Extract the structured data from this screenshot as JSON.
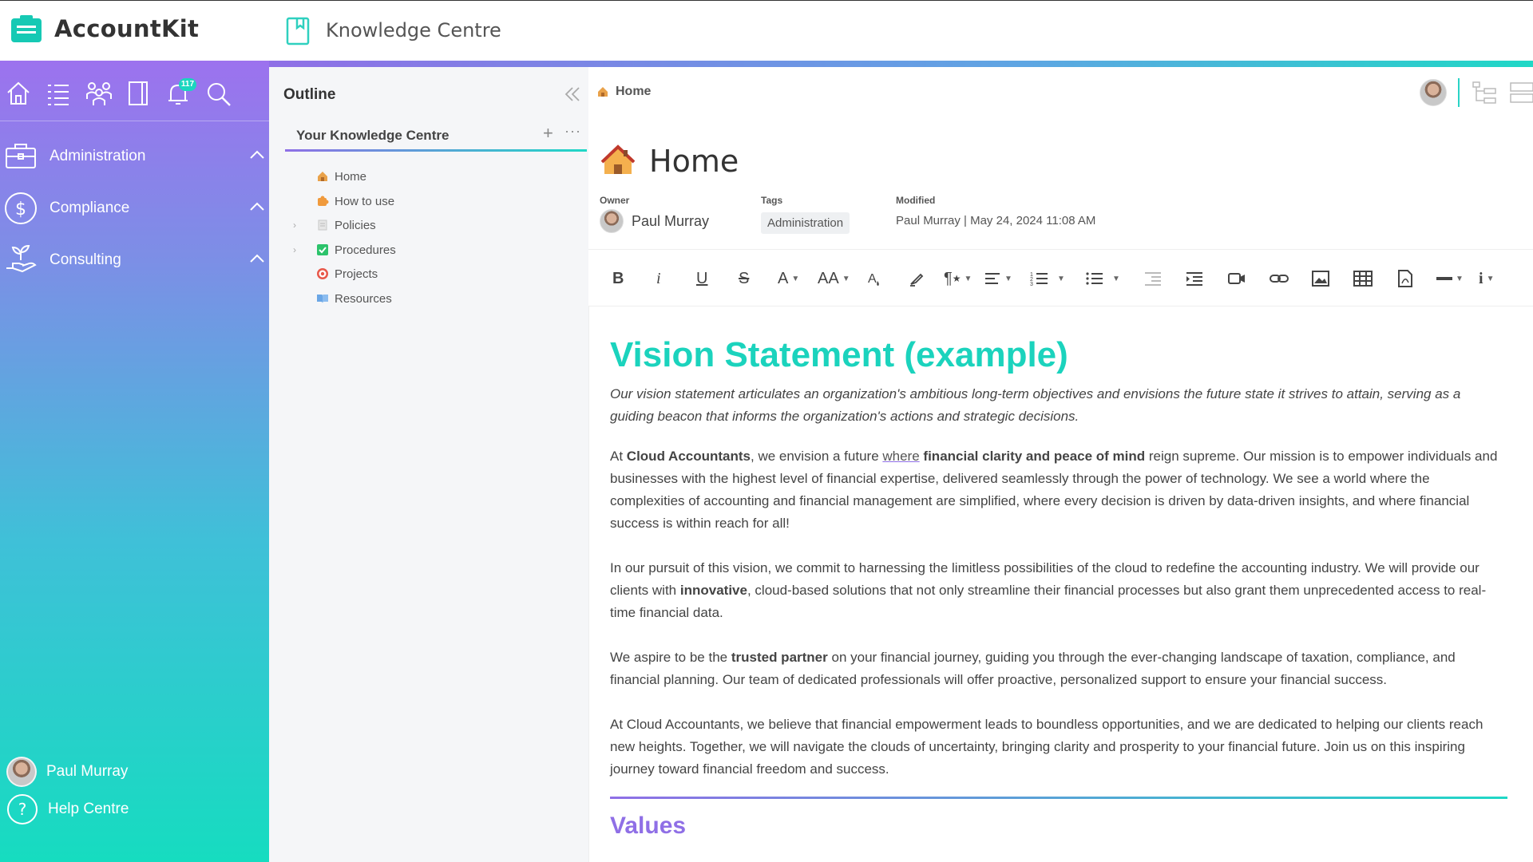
{
  "brand": {
    "name": "AccountKit"
  },
  "app": {
    "title": "Knowledge Centre"
  },
  "colors": {
    "accent_teal": "#1bd3bd",
    "accent_purple": "#8f6fe6"
  },
  "sidebar": {
    "notification_count": "117",
    "icons": [
      "home-icon",
      "list-icon",
      "team-icon",
      "book-icon",
      "bell-icon",
      "search-icon"
    ],
    "nav": [
      {
        "label": "Administration",
        "icon": "briefcase-icon"
      },
      {
        "label": "Compliance",
        "icon": "dollar-icon"
      },
      {
        "label": "Consulting",
        "icon": "hand-plant-icon"
      }
    ],
    "user": "Paul Murray",
    "help": "Help Centre"
  },
  "outline": {
    "title": "Outline",
    "tree_title": "Your Knowledge Centre",
    "plus": "+",
    "more": "···",
    "items": [
      {
        "label": "Home",
        "icon": "house-icon",
        "expandable": false
      },
      {
        "label": "How to use",
        "icon": "puzzle-icon",
        "expandable": false
      },
      {
        "label": "Policies",
        "icon": "document-icon",
        "expandable": true
      },
      {
        "label": "Procedures",
        "icon": "checkbox-icon",
        "expandable": true
      },
      {
        "label": "Projects",
        "icon": "target-icon",
        "expandable": false
      },
      {
        "label": "Resources",
        "icon": "open-book-icon",
        "expandable": false
      }
    ]
  },
  "content": {
    "breadcrumb": "Home",
    "title": "Home",
    "meta": {
      "owner_label": "Owner",
      "owner": "Paul Murray",
      "tags_label": "Tags",
      "tag": "Administration",
      "modified_label": "Modified",
      "modified": "Paul Murray | May 24, 2024 11:08 AM"
    },
    "toolbar": [
      "bold",
      "italic",
      "underline",
      "strikethrough",
      "font-color",
      "font-size",
      "clear-format",
      "highlighter",
      "paragraph-style",
      "align",
      "ordered-list",
      "unordered-list",
      "outdent",
      "indent",
      "video",
      "link",
      "image",
      "table",
      "pdf",
      "horizontal-rule",
      "more-info"
    ],
    "heading": "Vision Statement (example)",
    "intro": "Our vision statement articulates an organization's ambitious long-term objectives and envisions the future state it strives to attain, serving as a guiding beacon that informs the organization's actions and strategic decisions.",
    "p1": {
      "a": "At ",
      "b": "Cloud Accountants",
      "c": ", we envision a future ",
      "d": "where",
      "e": " ",
      "f": "financial clarity and peace of mind",
      "g": " reign supreme. Our mission is to empower individuals and businesses with the highest level of financial expertise, delivered seamlessly through the power of technology. We see a world where the complexities of accounting and financial management are simplified, where every decision is driven by data-driven insights, and where financial success is within reach for all!"
    },
    "p2": {
      "a": "In our pursuit of this vision, we commit to harnessing the limitless possibilities of the cloud to redefine the accounting industry. We will provide our clients with ",
      "b": "innovative",
      "c": ", cloud-based solutions that not only streamline their financial processes but also grant them unprecedented access to real-time financial data."
    },
    "p3": {
      "a": "We aspire to be the ",
      "b": "trusted partner",
      "c": " on your financial journey, guiding you through the ever-changing landscape of taxation, compliance, and financial planning. Our team of dedicated professionals will offer proactive, personalized support to ensure your financial success."
    },
    "p4": "At Cloud Accountants, we believe that financial empowerment leads to boundless opportunities, and we are dedicated to helping our clients reach new heights. Together, we will navigate the clouds of uncertainty, bringing clarity and prosperity to your financial future. Join us on this inspiring journey toward financial freedom and success.",
    "subheading": "Values"
  }
}
